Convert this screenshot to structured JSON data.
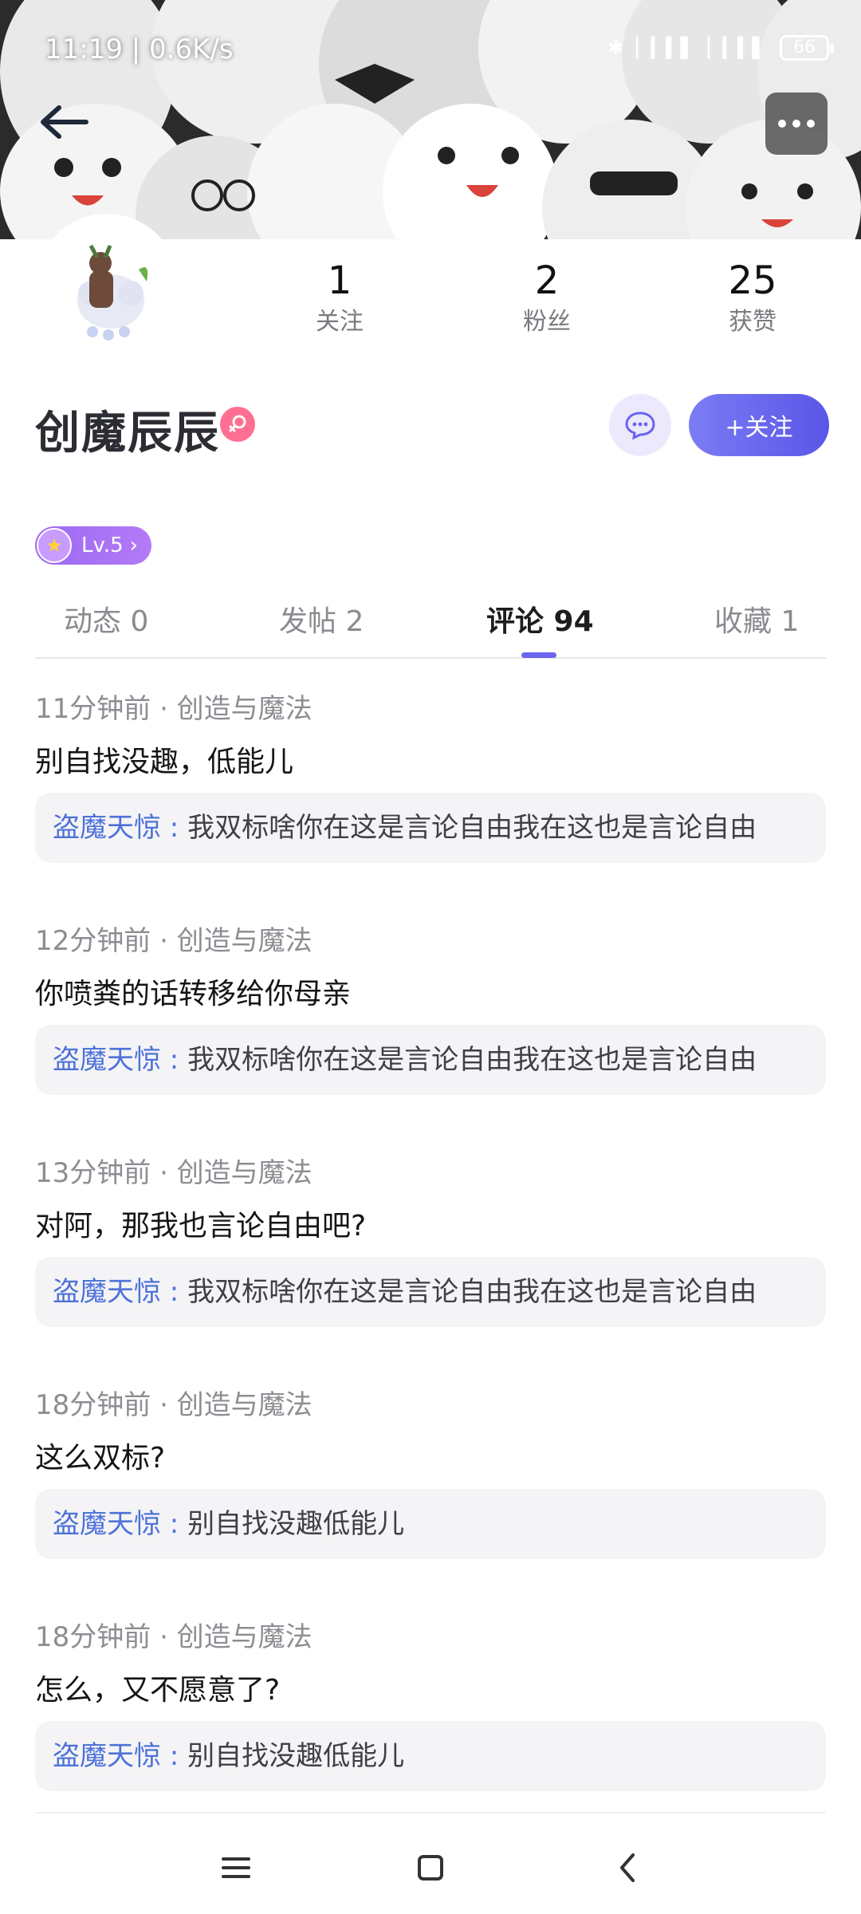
{
  "status_bar": {
    "time": "11:19 | 0.6K/s",
    "battery": "66"
  },
  "profile": {
    "name": "创魔辰辰",
    "level": "Lv.5",
    "follow_label": "+关注",
    "stats": [
      {
        "value": "1",
        "label": "关注"
      },
      {
        "value": "2",
        "label": "粉丝"
      },
      {
        "value": "25",
        "label": "获赞"
      }
    ]
  },
  "tabs": [
    {
      "label": "动态 0"
    },
    {
      "label": "发帖 2"
    },
    {
      "label": "评论 94"
    },
    {
      "label": "收藏 1"
    }
  ],
  "active_tab": "评论 94",
  "comments": [
    {
      "meta": "11分钟前 · 创造与魔法",
      "text": "别自找没趣，低能儿",
      "reply_user": "盗魔天惊 : ",
      "reply_text": "我双标啥你在这是言论自由我在这也是言论自由"
    },
    {
      "meta": "12分钟前 · 创造与魔法",
      "text": "你喷粪的话转移给你母亲",
      "reply_user": "盗魔天惊 : ",
      "reply_text": "我双标啥你在这是言论自由我在这也是言论自由"
    },
    {
      "meta": "13分钟前 · 创造与魔法",
      "text": "对阿，那我也言论自由吧?",
      "reply_user": "盗魔天惊 : ",
      "reply_text": "我双标啥你在这是言论自由我在这也是言论自由"
    },
    {
      "meta": "18分钟前 · 创造与魔法",
      "text": "这么双标?",
      "reply_user": "盗魔天惊 : ",
      "reply_text": "别自找没趣低能儿"
    },
    {
      "meta": "18分钟前 · 创造与魔法",
      "text": "怎么，又不愿意了?",
      "reply_user": "盗魔天惊 : ",
      "reply_text": "别自找没趣低能儿"
    }
  ],
  "icons": {
    "back": "arrow-left-icon",
    "more": "more-dots-icon",
    "message": "chat-bubble-icon",
    "gender": "female-icon",
    "level": "star-icon",
    "nav_menu": "menu-icon",
    "nav_home": "square-home-icon",
    "nav_back": "chevron-back-icon"
  },
  "colors": {
    "accent": "#6a64ef",
    "reply_user": "#4f72d9",
    "level_badge": "#9a6af2",
    "gender": "#ff6f91"
  }
}
